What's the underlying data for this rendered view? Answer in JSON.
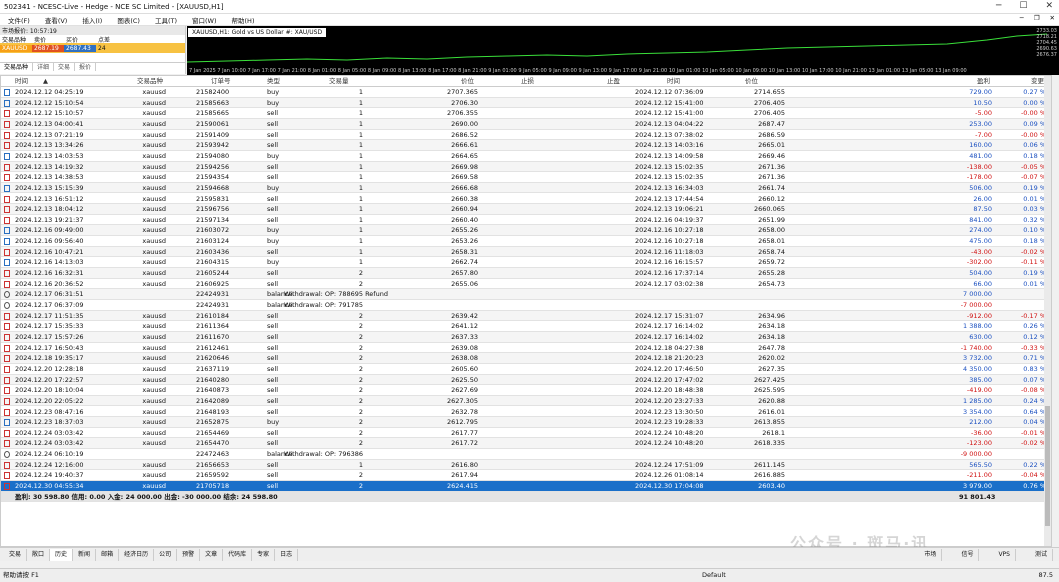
{
  "window": {
    "title": "502341 - NCESC-Live - Hedge - NCE SC Limited - [XAUUSD,H1]"
  },
  "menu": [
    "文件(F)",
    "查看(V)",
    "插入(I)",
    "图表(C)",
    "工具(T)",
    "窗口(W)",
    "帮助(H)"
  ],
  "market_watch": {
    "title": "市场报价: 10:57:19",
    "headers": [
      "交易品种",
      "卖价",
      "买价",
      "点差"
    ],
    "row": {
      "symbol": "XAUUSD",
      "bid": "2687.19",
      "ask": "2687.43",
      "spread": "24"
    },
    "tabs": [
      "交易品种",
      "详细",
      "交易",
      "报价"
    ]
  },
  "chart": {
    "tab_label": "XAUUSD,H1: Gold vs US Dollar #: XAU/USD",
    "y_labels": [
      "2733.03",
      "2718.21",
      "2704.45",
      "2690.63",
      "2676.37"
    ],
    "x_labels": [
      "7 Jan 2025",
      "7 Jan 10:00",
      "7 Jan 17:00",
      "7 Jan 21:00",
      "8 Jan 01:00",
      "8 Jan 05:00",
      "8 Jan 09:00",
      "8 Jan 13:00",
      "8 Jan 17:00",
      "8 Jan 21:00",
      "9 Jan 01:00",
      "9 Jan 05:00",
      "9 Jan 09:00",
      "9 Jan 13:00",
      "9 Jan 17:00",
      "9 Jan 21:00",
      "10 Jan 01:00",
      "10 Jan 05:00",
      "10 Jan 09:00",
      "10 Jan 13:00",
      "10 Jan 17:00",
      "10 Jan 21:00",
      "13 Jan 01:00",
      "13 Jan 05:00",
      "13 Jan 09:00"
    ]
  },
  "columns": [
    "时间",
    "交易品种",
    "订单号",
    "类型",
    "交易量",
    "价位",
    "止损",
    "止盈",
    "时间",
    "价位",
    "盈利",
    "变更"
  ],
  "rows": [
    {
      "t": "2024.12.12 04:25:19",
      "s": "xauusd",
      "o": "21582400",
      "ty": "buy",
      "v": "1",
      "p": "2707.365",
      "t2": "2024.12.12 07:36:09",
      "p2": "2714.655",
      "pr": "729.00",
      "ch": "0.27 %"
    },
    {
      "t": "2024.12.12 15:10:54",
      "s": "xauusd",
      "o": "21585663",
      "ty": "buy",
      "v": "1",
      "p": "2706.30",
      "t2": "2024.12.12 15:41:00",
      "p2": "2706.405",
      "pr": "10.50",
      "ch": "0.00 %"
    },
    {
      "t": "2024.12.12 15:10:57",
      "s": "xauusd",
      "o": "21585665",
      "ty": "sell",
      "v": "1",
      "p": "2706.355",
      "t2": "2024.12.12 15:41:00",
      "p2": "2706.405",
      "pr": "-5.00",
      "ch": "-0.00 %"
    },
    {
      "t": "2024.12.13 04:00:41",
      "s": "xauusd",
      "o": "21590061",
      "ty": "sell",
      "v": "1",
      "p": "2690.00",
      "t2": "2024.12.13 04:04:22",
      "p2": "2687.47",
      "pr": "253.00",
      "ch": "0.09 %"
    },
    {
      "t": "2024.12.13 07:21:19",
      "s": "xauusd",
      "o": "21591409",
      "ty": "sell",
      "v": "1",
      "p": "2686.52",
      "t2": "2024.12.13 07:38:02",
      "p2": "2686.59",
      "pr": "-7.00",
      "ch": "-0.00 %"
    },
    {
      "t": "2024.12.13 13:34:26",
      "s": "xauusd",
      "o": "21593942",
      "ty": "sell",
      "v": "1",
      "p": "2666.61",
      "t2": "2024.12.13 14:03:16",
      "p2": "2665.01",
      "pr": "160.00",
      "ch": "0.06 %"
    },
    {
      "t": "2024.12.13 14:03:53",
      "s": "xauusd",
      "o": "21594080",
      "ty": "buy",
      "v": "1",
      "p": "2664.65",
      "t2": "2024.12.13 14:09:58",
      "p2": "2669.46",
      "pr": "481.00",
      "ch": "0.18 %"
    },
    {
      "t": "2024.12.13 14:19:32",
      "s": "xauusd",
      "o": "21594256",
      "ty": "sell",
      "v": "1",
      "p": "2669.98",
      "t2": "2024.12.13 15:02:35",
      "p2": "2671.36",
      "pr": "-138.00",
      "ch": "-0.05 %"
    },
    {
      "t": "2024.12.13 14:38:53",
      "s": "xauusd",
      "o": "21594354",
      "ty": "sell",
      "v": "1",
      "p": "2669.58",
      "t2": "2024.12.13 15:02:35",
      "p2": "2671.36",
      "pr": "-178.00",
      "ch": "-0.07 %"
    },
    {
      "t": "2024.12.13 15:15:39",
      "s": "xauusd",
      "o": "21594668",
      "ty": "buy",
      "v": "1",
      "p": "2666.68",
      "t2": "2024.12.13 16:34:03",
      "p2": "2661.74",
      "pr": "506.00",
      "ch": "0.19 %"
    },
    {
      "t": "2024.12.13 16:51:12",
      "s": "xauusd",
      "o": "21595831",
      "ty": "sell",
      "v": "1",
      "p": "2660.38",
      "t2": "2024.12.13 17:44:54",
      "p2": "2660.12",
      "pr": "26.00",
      "ch": "0.01 %"
    },
    {
      "t": "2024.12.13 18:04:12",
      "s": "xauusd",
      "o": "21596756",
      "ty": "sell",
      "v": "1",
      "p": "2660.94",
      "t2": "2024.12.13 19:06:21",
      "p2": "2660.065",
      "pr": "87.50",
      "ch": "0.03 %"
    },
    {
      "t": "2024.12.13 19:21:37",
      "s": "xauusd",
      "o": "21597134",
      "ty": "sell",
      "v": "1",
      "p": "2660.40",
      "t2": "2024.12.16 04:19:37",
      "p2": "2651.99",
      "pr": "841.00",
      "ch": "0.32 %"
    },
    {
      "t": "2024.12.16 09:49:00",
      "s": "xauusd",
      "o": "21603072",
      "ty": "buy",
      "v": "1",
      "p": "2655.26",
      "t2": "2024.12.16 10:27:18",
      "p2": "2658.00",
      "pr": "274.00",
      "ch": "0.10 %"
    },
    {
      "t": "2024.12.16 09:56:40",
      "s": "xauusd",
      "o": "21603124",
      "ty": "buy",
      "v": "1",
      "p": "2653.26",
      "t2": "2024.12.16 10:27:18",
      "p2": "2658.01",
      "pr": "475.00",
      "ch": "0.18 %"
    },
    {
      "t": "2024.12.16 10:47:21",
      "s": "xauusd",
      "o": "21603436",
      "ty": "sell",
      "v": "1",
      "p": "2658.31",
      "t2": "2024.12.16 11:18:03",
      "p2": "2658.74",
      "pr": "-43.00",
      "ch": "-0.02 %"
    },
    {
      "t": "2024.12.16 14:13:03",
      "s": "xauusd",
      "o": "21604315",
      "ty": "buy",
      "v": "1",
      "p": "2662.74",
      "t2": "2024.12.16 16:15:57",
      "p2": "2659.72",
      "pr": "-302.00",
      "ch": "-0.11 %"
    },
    {
      "t": "2024.12.16 16:32:31",
      "s": "xauusd",
      "o": "21605244",
      "ty": "sell",
      "v": "2",
      "p": "2657.80",
      "t2": "2024.12.16 17:37:14",
      "p2": "2655.28",
      "pr": "504.00",
      "ch": "0.19 %"
    },
    {
      "t": "2024.12.16 20:36:52",
      "s": "xauusd",
      "o": "21606925",
      "ty": "sell",
      "v": "2",
      "p": "2655.06",
      "t2": "2024.12.17 03:02:38",
      "p2": "2654.73",
      "pr": "66.00",
      "ch": "0.01 %"
    },
    {
      "bal": true,
      "t": "2024.12.17 06:31:51",
      "o": "22424931",
      "ty": "balance",
      "note": "Withdrawal:  OP: 788695 Refund",
      "pr": "7 000.00",
      "ch": ""
    },
    {
      "bal": true,
      "t": "2024.12.17 06:37:09",
      "o": "22424931",
      "ty": "balance",
      "note": "Withdrawal:  OP: 791785",
      "pr": "-7 000.00",
      "ch": ""
    },
    {
      "t": "2024.12.17 11:51:35",
      "s": "xauusd",
      "o": "21610184",
      "ty": "sell",
      "v": "2",
      "p": "2639.42",
      "t2": "2024.12.17 15:31:07",
      "p2": "2634.96",
      "pr": "-912.00",
      "ch": "-0.17 %"
    },
    {
      "t": "2024.12.17 15:35:33",
      "s": "xauusd",
      "o": "21611364",
      "ty": "sell",
      "v": "2",
      "p": "2641.12",
      "t2": "2024.12.17 16:14:02",
      "p2": "2634.18",
      "pr": "1 388.00",
      "ch": "0.26 %"
    },
    {
      "t": "2024.12.17 15:57:26",
      "s": "xauusd",
      "o": "21611670",
      "ty": "sell",
      "v": "2",
      "p": "2637.33",
      "t2": "2024.12.17 16:14:02",
      "p2": "2634.18",
      "pr": "630.00",
      "ch": "0.12 %"
    },
    {
      "t": "2024.12.17 16:50:43",
      "s": "xauusd",
      "o": "21612461",
      "ty": "sell",
      "v": "2",
      "p": "2639.08",
      "t2": "2024.12.18 04:27:38",
      "p2": "2647.78",
      "pr": "-1 740.00",
      "ch": "-0.33 %"
    },
    {
      "t": "2024.12.18 19:35:17",
      "s": "xauusd",
      "o": "21620646",
      "ty": "sell",
      "v": "2",
      "p": "2638.08",
      "t2": "2024.12.18 21:20:23",
      "p2": "2620.02",
      "pr": "3 732.00",
      "ch": "0.71 %"
    },
    {
      "t": "2024.12.20 12:28:18",
      "s": "xauusd",
      "o": "21637119",
      "ty": "sell",
      "v": "2",
      "p": "2605.60",
      "t2": "2024.12.20 17:46:50",
      "p2": "2627.35",
      "pr": "4 350.00",
      "ch": "0.83 %"
    },
    {
      "t": "2024.12.20 17:22:57",
      "s": "xauusd",
      "o": "21640280",
      "ty": "sell",
      "v": "2",
      "p": "2625.50",
      "t2": "2024.12.20 17:47:02",
      "p2": "2627.425",
      "pr": "385.00",
      "ch": "0.07 %"
    },
    {
      "t": "2024.12.20 18:10:04",
      "s": "xauusd",
      "o": "21640873",
      "ty": "sell",
      "v": "2",
      "p": "2627.69",
      "t2": "2024.12.20 18:48:38",
      "p2": "2625.595",
      "pr": "-419.00",
      "ch": "-0.08 %"
    },
    {
      "t": "2024.12.20 22:05:22",
      "s": "xauusd",
      "o": "21642089",
      "ty": "sell",
      "v": "2",
      "p": "2627.305",
      "t2": "2024.12.20 23:27:33",
      "p2": "2620.88",
      "pr": "1 285.00",
      "ch": "0.24 %"
    },
    {
      "t": "2024.12.23 08:47:16",
      "s": "xauusd",
      "o": "21648193",
      "ty": "sell",
      "v": "2",
      "p": "2632.78",
      "t2": "2024.12.23 13:30:50",
      "p2": "2616.01",
      "pr": "3 354.00",
      "ch": "0.64 %"
    },
    {
      "t": "2024.12.23 18:37:03",
      "s": "xauusd",
      "o": "21652875",
      "ty": "buy",
      "v": "2",
      "p": "2612.795",
      "t2": "2024.12.23 19:28:33",
      "p2": "2613.855",
      "pr": "212.00",
      "ch": "0.04 %"
    },
    {
      "t": "2024.12.24 03:03:42",
      "s": "xauusd",
      "o": "21654469",
      "ty": "sell",
      "v": "2",
      "p": "2617.77",
      "t2": "2024.12.24 10:48:20",
      "p2": "2618.1",
      "pr": "-36.00",
      "ch": "-0.01 %"
    },
    {
      "t": "2024.12.24 03:03:42",
      "s": "xauusd",
      "o": "21654470",
      "ty": "sell",
      "v": "2",
      "p": "2617.72",
      "t2": "2024.12.24 10:48:20",
      "p2": "2618.335",
      "pr": "-123.00",
      "ch": "-0.02 %"
    },
    {
      "bal": true,
      "t": "2024.12.24 06:10:19",
      "o": "22472463",
      "ty": "balance",
      "note": "Withdrawal:  OP: 796386",
      "pr": "-9 000.00",
      "ch": ""
    },
    {
      "t": "2024.12.24 12:16:00",
      "s": "xauusd",
      "o": "21656653",
      "ty": "sell",
      "v": "1",
      "p": "2616.80",
      "t2": "2024.12.24 17:51:09",
      "p2": "2611.145",
      "pr": "565.50",
      "ch": "0.22 %"
    },
    {
      "t": "2024.12.24 19:40:37",
      "s": "xauusd",
      "o": "21659592",
      "ty": "sell",
      "v": "2",
      "p": "2617.94",
      "t2": "2024.12.26 01:08:14",
      "p2": "2616.885",
      "pr": "-211.00",
      "ch": "-0.04 %"
    },
    {
      "t": "2024.12.30 04:55:34",
      "s": "xauusd",
      "o": "21705718",
      "ty": "sell",
      "v": "2",
      "p": "2624.415",
      "t2": "2024.12.30 17:04:08",
      "p2": "2603.40",
      "pr": "3 979.00",
      "ch": "0.76 %",
      "sel": true
    }
  ],
  "summary": "盈利: 30 598.80  信用: 0.00  入金: 24 000.00  出金: -30 000.00  结余: 24 598.80",
  "summary_right": "91 801.43",
  "bottom_tabs": [
    "交易",
    "敞口",
    "历史",
    "新闻",
    "邮箱",
    "经济日历",
    "公司",
    "预警",
    "文章",
    "代码库",
    "专家",
    "日志"
  ],
  "bottom_right": [
    "市场",
    "信号",
    "VPS",
    "测试"
  ],
  "status": {
    "left": "帮助请按 F1",
    "mid": "Default",
    "right": "87.5"
  },
  "watermark": "公众号 · 斑马·讯"
}
